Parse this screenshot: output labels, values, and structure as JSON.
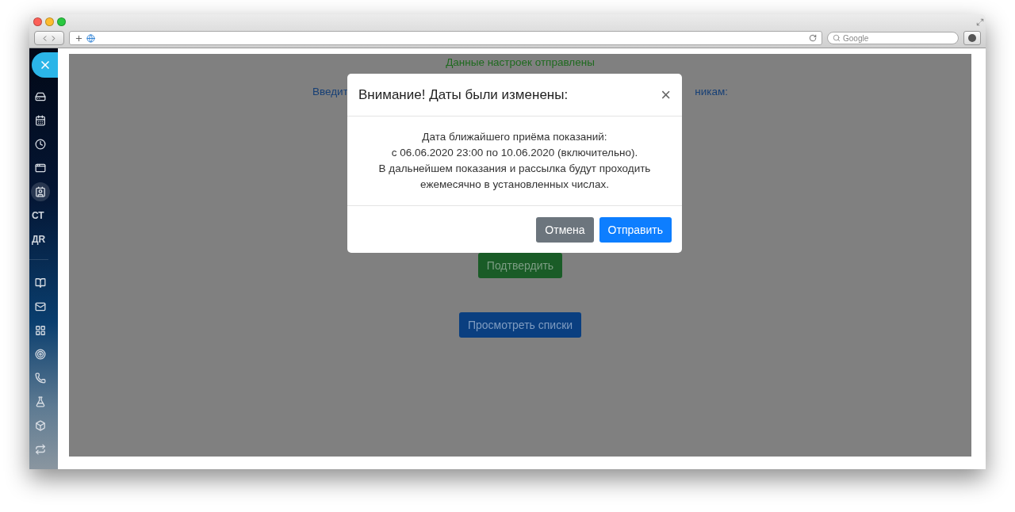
{
  "browser": {
    "search_placeholder": "Google"
  },
  "sidebar": {
    "items": [
      {
        "kind": "icon",
        "selected": false
      },
      {
        "kind": "icon",
        "selected": false
      },
      {
        "kind": "icon",
        "selected": false
      },
      {
        "kind": "icon",
        "selected": false
      },
      {
        "kind": "icon",
        "selected": true
      },
      {
        "kind": "text",
        "label": "СТ",
        "selected": false
      },
      {
        "kind": "text",
        "label": "ДR",
        "selected": false
      },
      {
        "kind": "divider"
      },
      {
        "kind": "icon",
        "selected": false
      },
      {
        "kind": "icon",
        "selected": false
      },
      {
        "kind": "icon",
        "selected": false
      },
      {
        "kind": "icon",
        "selected": false
      },
      {
        "kind": "icon",
        "selected": false
      },
      {
        "kind": "icon",
        "selected": false
      },
      {
        "kind": "icon",
        "selected": false
      },
      {
        "kind": "icon",
        "selected": false
      }
    ]
  },
  "page": {
    "status_message": "Данные настроек отправлены",
    "instruction_left": "Введит",
    "instruction_right": "никам:",
    "buttons": [
      {
        "label": "Подтвердить",
        "kind": "success"
      },
      {
        "label": "Просмотреть списки",
        "kind": "primary"
      }
    ]
  },
  "modal": {
    "title": "Внимание! Даты были изменены:",
    "close_symbol": "×",
    "body_lines": [
      "Дата ближайшего приёма показаний:",
      "с 06.06.2020 23:00 по 10.06.2020 (включительно).",
      "В дальнейшем показания и рассылка будут проходить",
      "ежемесячно в установленных числах."
    ],
    "buttons": [
      {
        "label": "Отмена",
        "kind": "secondary"
      },
      {
        "label": "Отправить",
        "kind": "primary"
      }
    ]
  }
}
